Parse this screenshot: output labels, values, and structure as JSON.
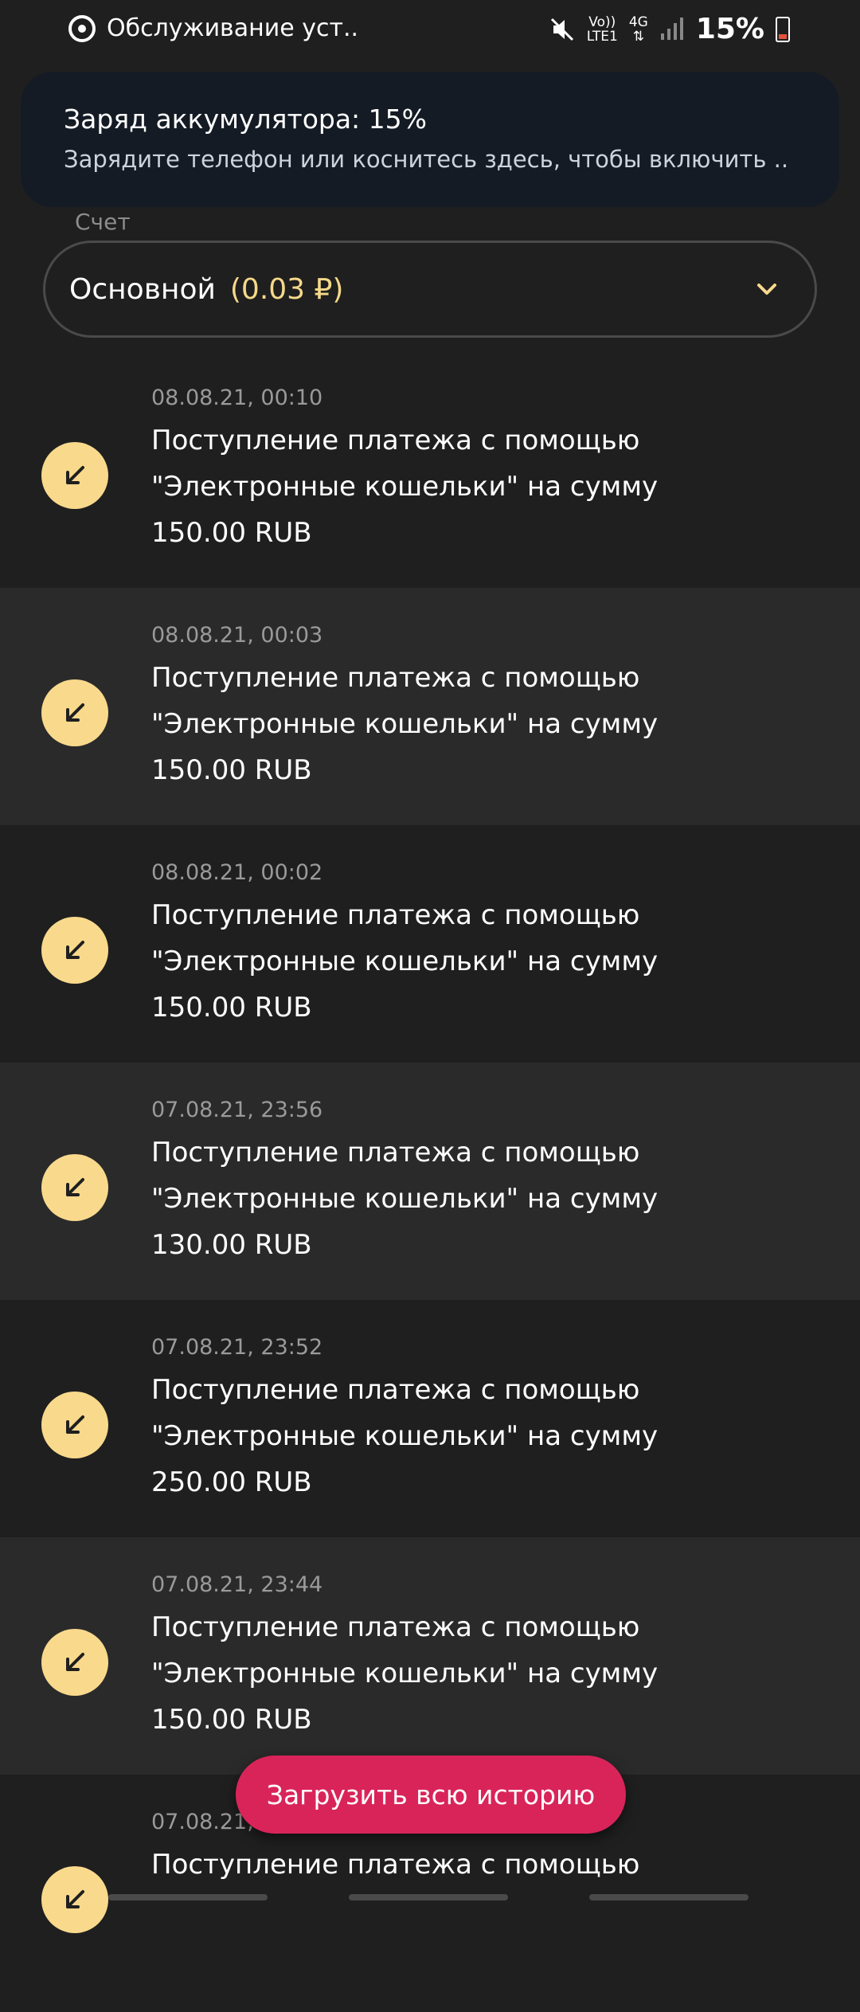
{
  "status_bar": {
    "app_title": "Обслуживание уст..",
    "volte_label": "Vo))\nLTE1",
    "network_label": "4G",
    "battery_percent": "15%"
  },
  "notification": {
    "title": "Заряд аккумулятора: 15%",
    "body": "Зарядите телефон или коснитесь здесь, чтобы включить .."
  },
  "account": {
    "label": "Счет",
    "name": "Основной",
    "balance": "(0.03 ₽)"
  },
  "transactions": [
    {
      "date": "08.08.21, 00:10",
      "description": "Поступление платежа с помощью \"Электронные кошельки\" на сумму 150.00 RUB"
    },
    {
      "date": "08.08.21, 00:03",
      "description": "Поступление платежа с помощью \"Электронные кошельки\" на сумму 150.00 RUB"
    },
    {
      "date": "08.08.21, 00:02",
      "description": "Поступление платежа с помощью \"Электронные кошельки\" на сумму 150.00 RUB"
    },
    {
      "date": "07.08.21, 23:56",
      "description": "Поступление платежа с помощью \"Электронные кошельки\" на сумму 130.00 RUB"
    },
    {
      "date": "07.08.21, 23:52",
      "description": "Поступление платежа с помощью \"Электронные кошельки\" на сумму 250.00 RUB"
    },
    {
      "date": "07.08.21, 23:44",
      "description": "Поступление платежа с помощью \"Электронные кошельки\" на сумму 150.00 RUB"
    },
    {
      "date": "07.08.21, ",
      "description": "Поступление платежа с помощью"
    }
  ],
  "load_all_label": "Загрузить всю историю",
  "colors": {
    "accent_yellow": "#f9d98c",
    "button_pink": "#d9245a",
    "background": "#1f1f1f",
    "row_alt": "#2a2a2a"
  }
}
